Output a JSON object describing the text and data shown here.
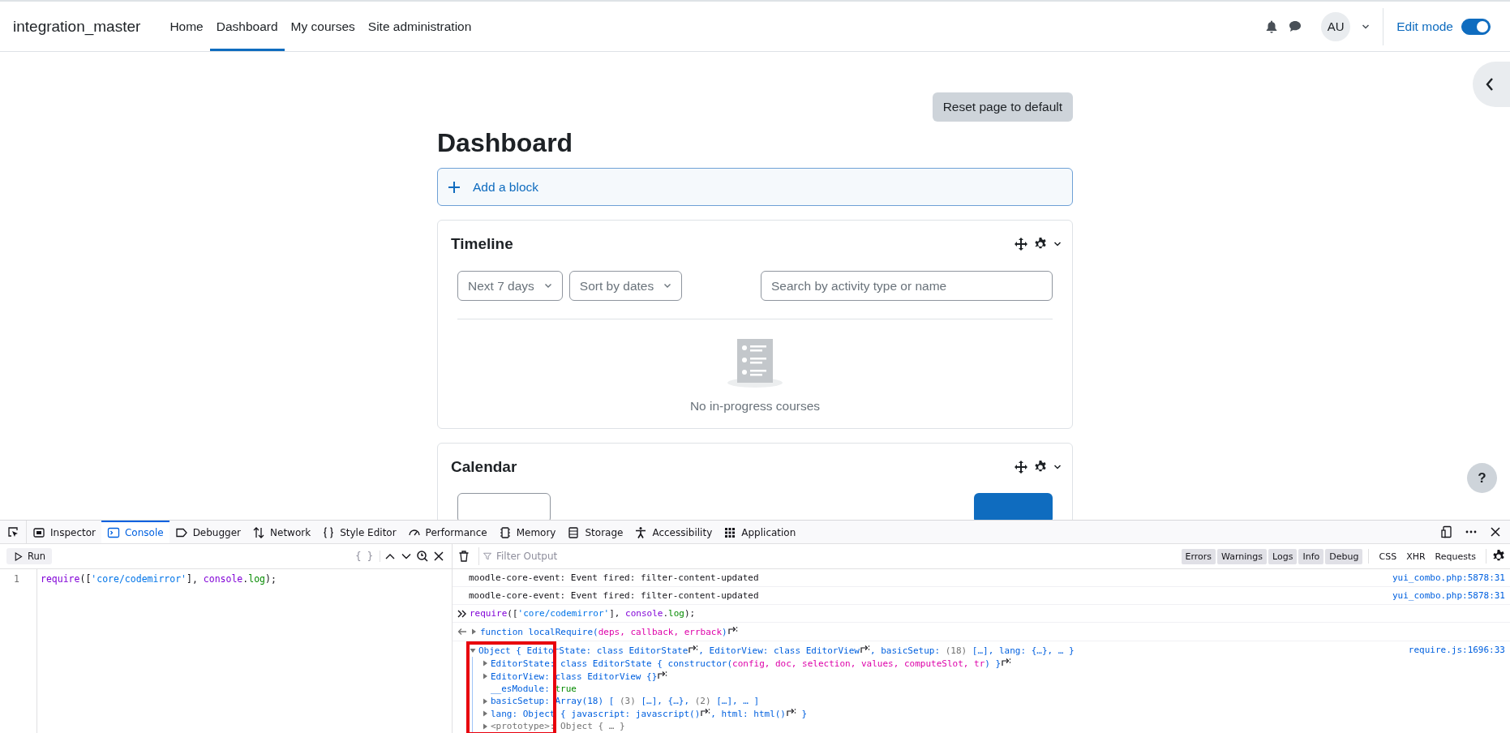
{
  "navbar": {
    "site_name": "integration_master",
    "nav_items": [
      {
        "label": "Home",
        "selected": false
      },
      {
        "label": "Dashboard",
        "selected": true
      },
      {
        "label": "My courses",
        "selected": false
      },
      {
        "label": "Site administration",
        "selected": false
      }
    ],
    "avatar": "AU",
    "edit_mode": {
      "label": "Edit mode",
      "on": true
    }
  },
  "page": {
    "reset_button": "Reset page to default",
    "title": "Dashboard",
    "add_block": "Add a block",
    "blocks": [
      {
        "kind": "timeline",
        "title": "Timeline",
        "filters": [
          "Next 7 days",
          "Sort by dates"
        ],
        "search_placeholder": "Search by activity type or name",
        "empty_text": "No in-progress courses"
      },
      {
        "kind": "calendar",
        "title": "Calendar"
      }
    ]
  },
  "help_button": "?",
  "devtools": {
    "tabs": [
      {
        "label": "Inspector",
        "selected": false
      },
      {
        "label": "Console",
        "selected": true
      },
      {
        "label": "Debugger",
        "selected": false
      },
      {
        "label": "Network",
        "selected": false
      },
      {
        "label": "Style Editor",
        "selected": false
      },
      {
        "label": "Performance",
        "selected": false
      },
      {
        "label": "Memory",
        "selected": false
      },
      {
        "label": "Storage",
        "selected": false
      },
      {
        "label": "Accessibility",
        "selected": false
      },
      {
        "label": "Application",
        "selected": false
      }
    ],
    "editor": {
      "run_label": "Run",
      "pretty_print": "{ }",
      "lines": [
        {
          "number": "1",
          "tokens": [
            {
              "kind": "keyword",
              "text": "require"
            },
            {
              "kind": "punct",
              "text": "(["
            },
            {
              "kind": "string",
              "text": "'core/codemirror'"
            },
            {
              "kind": "punct",
              "text": "], "
            },
            {
              "kind": "keyword",
              "text": "console"
            },
            {
              "kind": "punct",
              "text": "."
            },
            {
              "kind": "property",
              "text": "log"
            },
            {
              "kind": "punct",
              "text": ");"
            }
          ]
        }
      ]
    },
    "console": {
      "filter_placeholder": "Filter Output",
      "levels": [
        {
          "label": "Errors",
          "selected": true
        },
        {
          "label": "Warnings",
          "selected": true
        },
        {
          "label": "Logs",
          "selected": true
        },
        {
          "label": "Info",
          "selected": true
        },
        {
          "label": "Debug",
          "selected": true
        }
      ],
      "categories": [
        {
          "label": "CSS",
          "selected": false
        },
        {
          "label": "XHR",
          "selected": false
        },
        {
          "label": "Requests",
          "selected": false
        }
      ],
      "messages": [
        {
          "kind": "log",
          "text": "moodle-core-event: Event fired: filter-content-updated",
          "source": "yui_combo.php:5878:31"
        },
        {
          "kind": "log",
          "text": "moodle-core-event: Event fired: filter-content-updated",
          "source": "yui_combo.php:5878:31"
        },
        {
          "kind": "input",
          "tokens": [
            {
              "kind": "keyword",
              "text": "require"
            },
            {
              "kind": "punct",
              "text": "(["
            },
            {
              "kind": "string",
              "text": "'core/codemirror'"
            },
            {
              "kind": "punct",
              "text": "], "
            },
            {
              "kind": "keyword",
              "text": "console"
            },
            {
              "kind": "punct",
              "text": "."
            },
            {
              "kind": "property",
              "text": "log"
            },
            {
              "kind": "punct",
              "text": ");"
            }
          ]
        },
        {
          "kind": "result",
          "expanded": false,
          "tokens": [
            {
              "kind": "obj",
              "text": "function localRequire("
            },
            {
              "kind": "param",
              "text": "deps, callback, errback"
            },
            {
              "kind": "obj",
              "text": ")"
            },
            {
              "kind": "jump"
            }
          ]
        },
        {
          "kind": "object",
          "expanded": true,
          "source": "require.js:1696:33",
          "tokens": [
            {
              "kind": "obj",
              "text": "Object { EditorState: class EditorState"
            },
            {
              "kind": "jump"
            },
            {
              "kind": "obj",
              "text": ", EditorView: class EditorView"
            },
            {
              "kind": "jump"
            },
            {
              "kind": "obj",
              "text": ", basicSetup: "
            },
            {
              "kind": "muted",
              "text": "(18)"
            },
            {
              "kind": "obj",
              "text": " […], lang: {…}, … }"
            }
          ],
          "children": [
            {
              "expandable": true,
              "tokens": [
                {
                  "kind": "obj",
                  "text": "EditorState: class EditorState { constructor("
                },
                {
                  "kind": "param",
                  "text": "config, doc, selection, values, computeSlot, tr"
                },
                {
                  "kind": "obj",
                  "text": ") }"
                },
                {
                  "kind": "jump"
                }
              ]
            },
            {
              "expandable": true,
              "tokens": [
                {
                  "kind": "obj",
                  "text": "EditorView: class EditorView {}"
                },
                {
                  "kind": "jump"
                }
              ]
            },
            {
              "expandable": false,
              "tokens": [
                {
                  "kind": "obj",
                  "text": "__esModule: "
                },
                {
                  "kind": "bool",
                  "text": "true"
                }
              ]
            },
            {
              "expandable": true,
              "tokens": [
                {
                  "kind": "obj",
                  "text": "basicSetup: Array(18) [ "
                },
                {
                  "kind": "muted",
                  "text": "(3)"
                },
                {
                  "kind": "obj",
                  "text": " […], {…}, "
                },
                {
                  "kind": "muted",
                  "text": "(2)"
                },
                {
                  "kind": "obj",
                  "text": " […], … ]"
                }
              ]
            },
            {
              "expandable": true,
              "tokens": [
                {
                  "kind": "obj",
                  "text": "lang: Object { javascript: javascript()"
                },
                {
                  "kind": "jump"
                },
                {
                  "kind": "obj",
                  "text": ", html: html()"
                },
                {
                  "kind": "jump"
                },
                {
                  "kind": "obj",
                  "text": " }"
                }
              ]
            },
            {
              "expandable": true,
              "tokens": [
                {
                  "kind": "muted",
                  "text": "<prototype>: Object { … }"
                }
              ]
            }
          ]
        }
      ]
    }
  }
}
